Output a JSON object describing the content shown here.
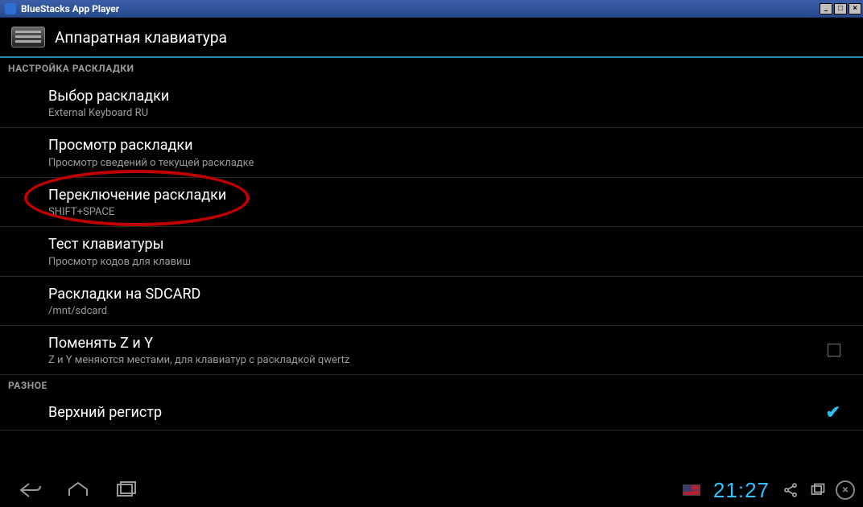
{
  "window_title": "BlueStacks App Player",
  "header_title": "Аппаратная клавиатура",
  "sections": {
    "layout": "НАСТРОЙКА РАСКЛАДКИ",
    "misc": "РАЗНОЕ"
  },
  "items": {
    "choose_layout": {
      "title": "Выбор раскладки",
      "sub": "External Keyboard RU"
    },
    "view_layout": {
      "title": "Просмотр раскладки",
      "sub": "Просмотр сведений о текущей раскладке"
    },
    "switch_layout": {
      "title": "Переключение раскладки",
      "sub": "SHIFT+SPACE"
    },
    "test_kbd": {
      "title": "Тест клавиатуры",
      "sub": "Просмотр кодов для клавиш"
    },
    "sdcard": {
      "title": "Раскладки на SDCARD",
      "sub": "/mnt/sdcard"
    },
    "swap_zy": {
      "title": "Поменять Z и Y",
      "sub": "Z и Y меняются местами, для клавиатур с раскладкой qwertz"
    },
    "uppercase": {
      "title": "Верхний регистр"
    }
  },
  "statusbar": {
    "time": "21:27"
  }
}
